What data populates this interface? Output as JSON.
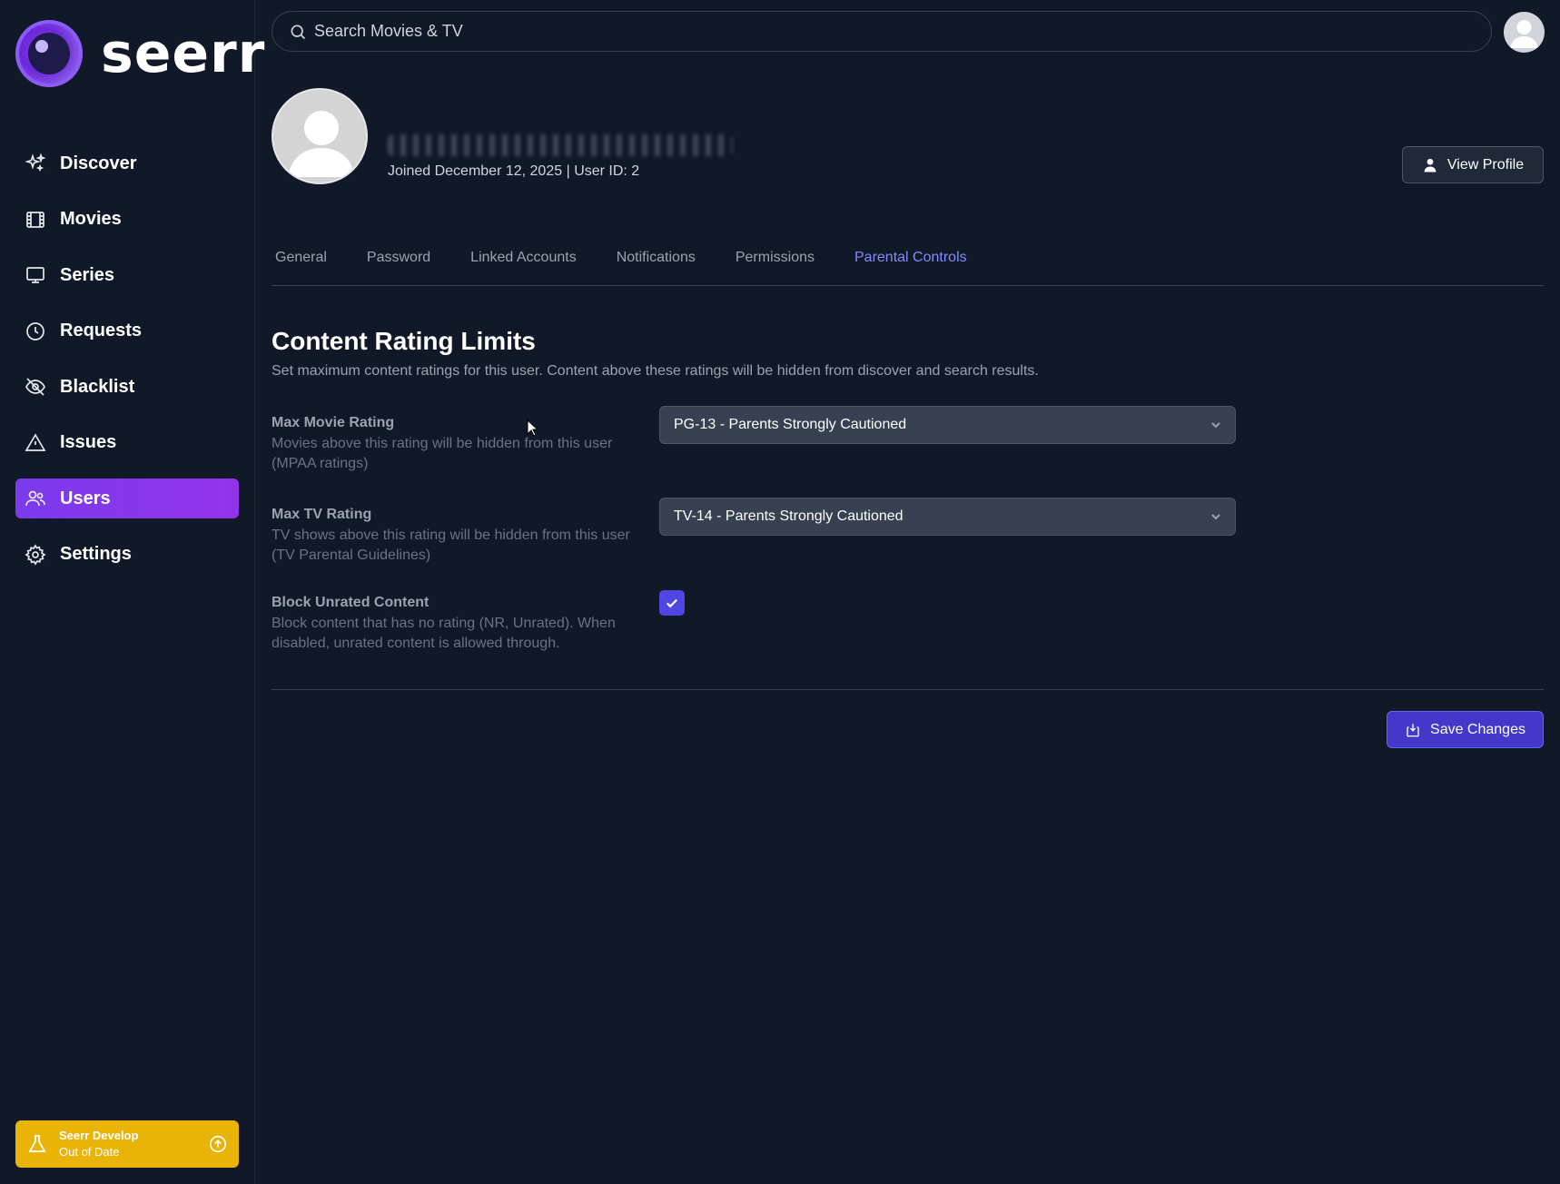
{
  "app": {
    "name": "seerr"
  },
  "sidebar": {
    "items": [
      {
        "label": "Discover",
        "icon": "sparkles-icon"
      },
      {
        "label": "Movies",
        "icon": "film-icon"
      },
      {
        "label": "Series",
        "icon": "tv-icon"
      },
      {
        "label": "Requests",
        "icon": "clock-icon"
      },
      {
        "label": "Blacklist",
        "icon": "eye-slash-icon"
      },
      {
        "label": "Issues",
        "icon": "warning-icon"
      },
      {
        "label": "Users",
        "icon": "users-icon",
        "active": true
      },
      {
        "label": "Settings",
        "icon": "gear-icon"
      }
    ],
    "version": {
      "line1": "Seerr Develop",
      "line2": "Out of Date"
    }
  },
  "search": {
    "placeholder": "Search Movies & TV"
  },
  "profile": {
    "joined": "Joined December 12, 2025",
    "separator": "|",
    "user_id": "User ID: 2",
    "view_profile_label": "View Profile"
  },
  "tabs": [
    {
      "label": "General"
    },
    {
      "label": "Password"
    },
    {
      "label": "Linked Accounts"
    },
    {
      "label": "Notifications"
    },
    {
      "label": "Permissions"
    },
    {
      "label": "Parental Controls",
      "active": true
    }
  ],
  "section": {
    "title": "Content Rating Limits",
    "description": "Set maximum content ratings for this user. Content above these ratings will be hidden from discover and search results."
  },
  "fields": {
    "movie": {
      "label": "Max Movie Rating",
      "help": "Movies above this rating will be hidden from this user (MPAA ratings)",
      "value": "PG-13 - Parents Strongly Cautioned"
    },
    "tv": {
      "label": "Max TV Rating",
      "help": "TV shows above this rating will be hidden from this user (TV Parental Guidelines)",
      "value": "TV-14 - Parents Strongly Cautioned"
    },
    "unrated": {
      "label": "Block Unrated Content",
      "help": "Block content that has no rating (NR, Unrated). When disabled, unrated content is allowed through.",
      "checked": true
    }
  },
  "actions": {
    "save_label": "Save Changes"
  },
  "colors": {
    "accent": "#4f46e5",
    "active_tab": "#818cf8",
    "active_nav": "#7c3aed",
    "badge": "#eab308"
  }
}
